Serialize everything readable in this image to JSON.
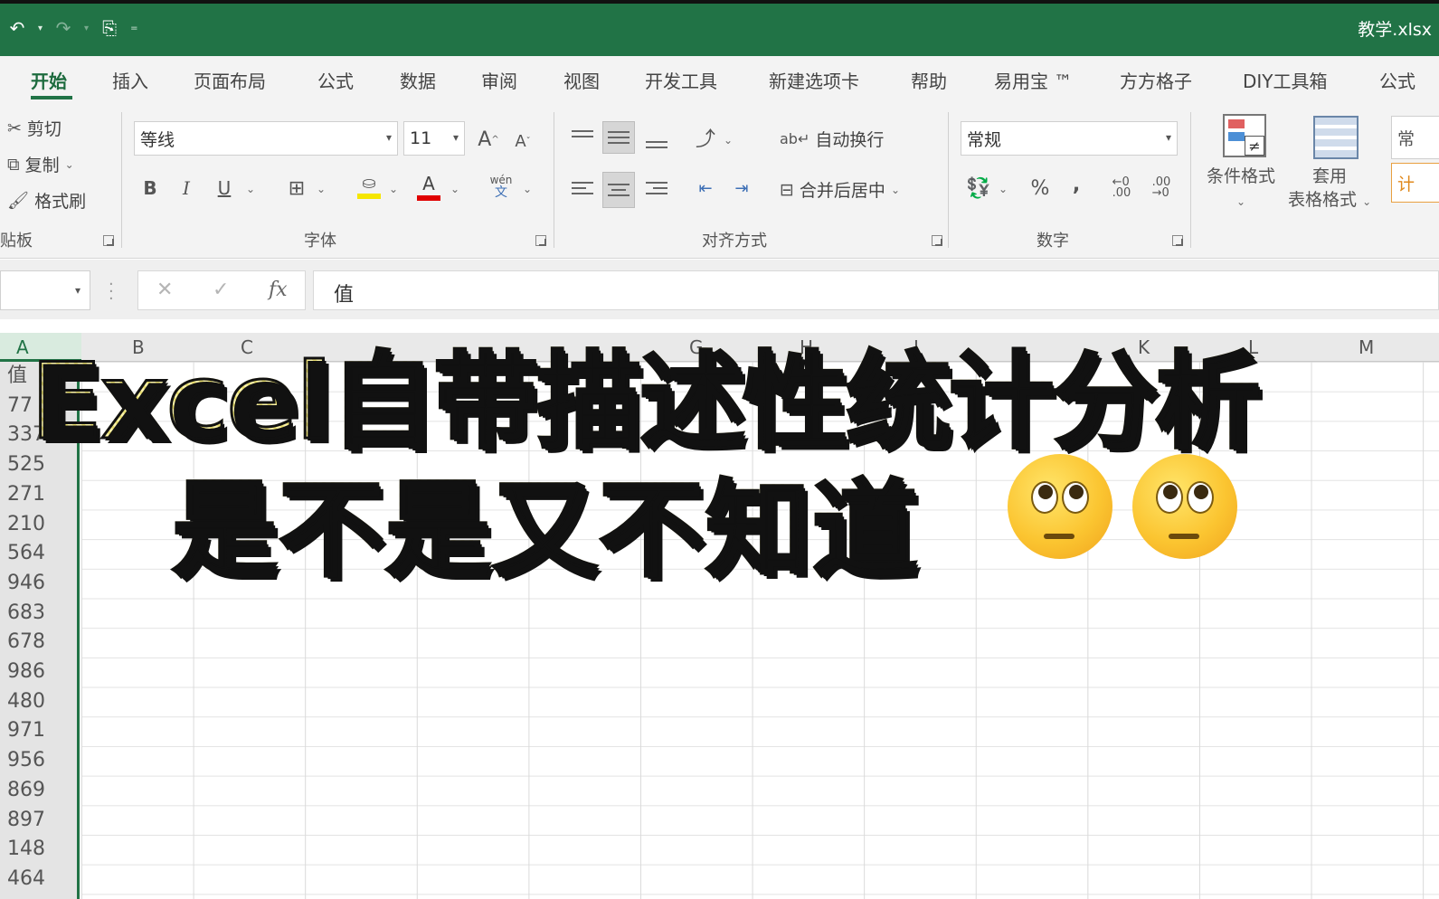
{
  "window": {
    "filename": "教学.xlsx"
  },
  "qat": {
    "undo": "undo-icon",
    "redo": "redo-icon",
    "touch_mode": "touch-mode-icon",
    "customize": "customize-qat-icon"
  },
  "ribbon_tabs": [
    "开始",
    "插入",
    "页面布局",
    "公式",
    "数据",
    "审阅",
    "视图",
    "开发工具",
    "新建选项卡",
    "帮助",
    "易用宝 ™",
    "方方格子",
    "DIY工具箱",
    "公式"
  ],
  "clipboard": {
    "cut": "剪切",
    "copy": "复制",
    "format_painter": "格式刷",
    "group_label": "贴板"
  },
  "font": {
    "name": "等线",
    "size": "11",
    "bold": "B",
    "italic": "I",
    "underline": "U",
    "wen": "wén",
    "wen2": "文",
    "group_label": "字体",
    "increase": "A",
    "decrease": "A"
  },
  "alignment": {
    "wrap_text": "自动换行",
    "merge_center": "合并后居中",
    "group_label": "对齐方式"
  },
  "number": {
    "format": "常规",
    "percent": "%",
    "comma": ",",
    "group_label": "数字"
  },
  "styles": {
    "conditional_format": "条件格式",
    "table_format_1": "套用",
    "table_format_2": "表格格式",
    "cell_styles_partial": "常",
    "cell_styles_partial2": "计"
  },
  "formula_bar": {
    "cancel": "✕",
    "enter": "✓",
    "fx": "fx",
    "content": "值"
  },
  "sheet": {
    "columns": [
      "A",
      "B",
      "C",
      "G",
      "H",
      "I",
      "K",
      "L",
      "M"
    ],
    "rows": [
      "值",
      "77",
      "337",
      "525",
      "271",
      "210",
      "564",
      "946",
      "683",
      "678",
      "986",
      "480",
      "971",
      "956",
      "869",
      "897",
      "148",
      "464"
    ]
  },
  "caption": {
    "line1": "Excel自带描述性统计分析",
    "line2": "是不是又不知道",
    "emoji": "face-with-rolling-eyes-emoji"
  },
  "colors": {
    "excel_green": "#217346",
    "caption_fill": "#f6ec8e",
    "caption_outline": "#111111"
  }
}
